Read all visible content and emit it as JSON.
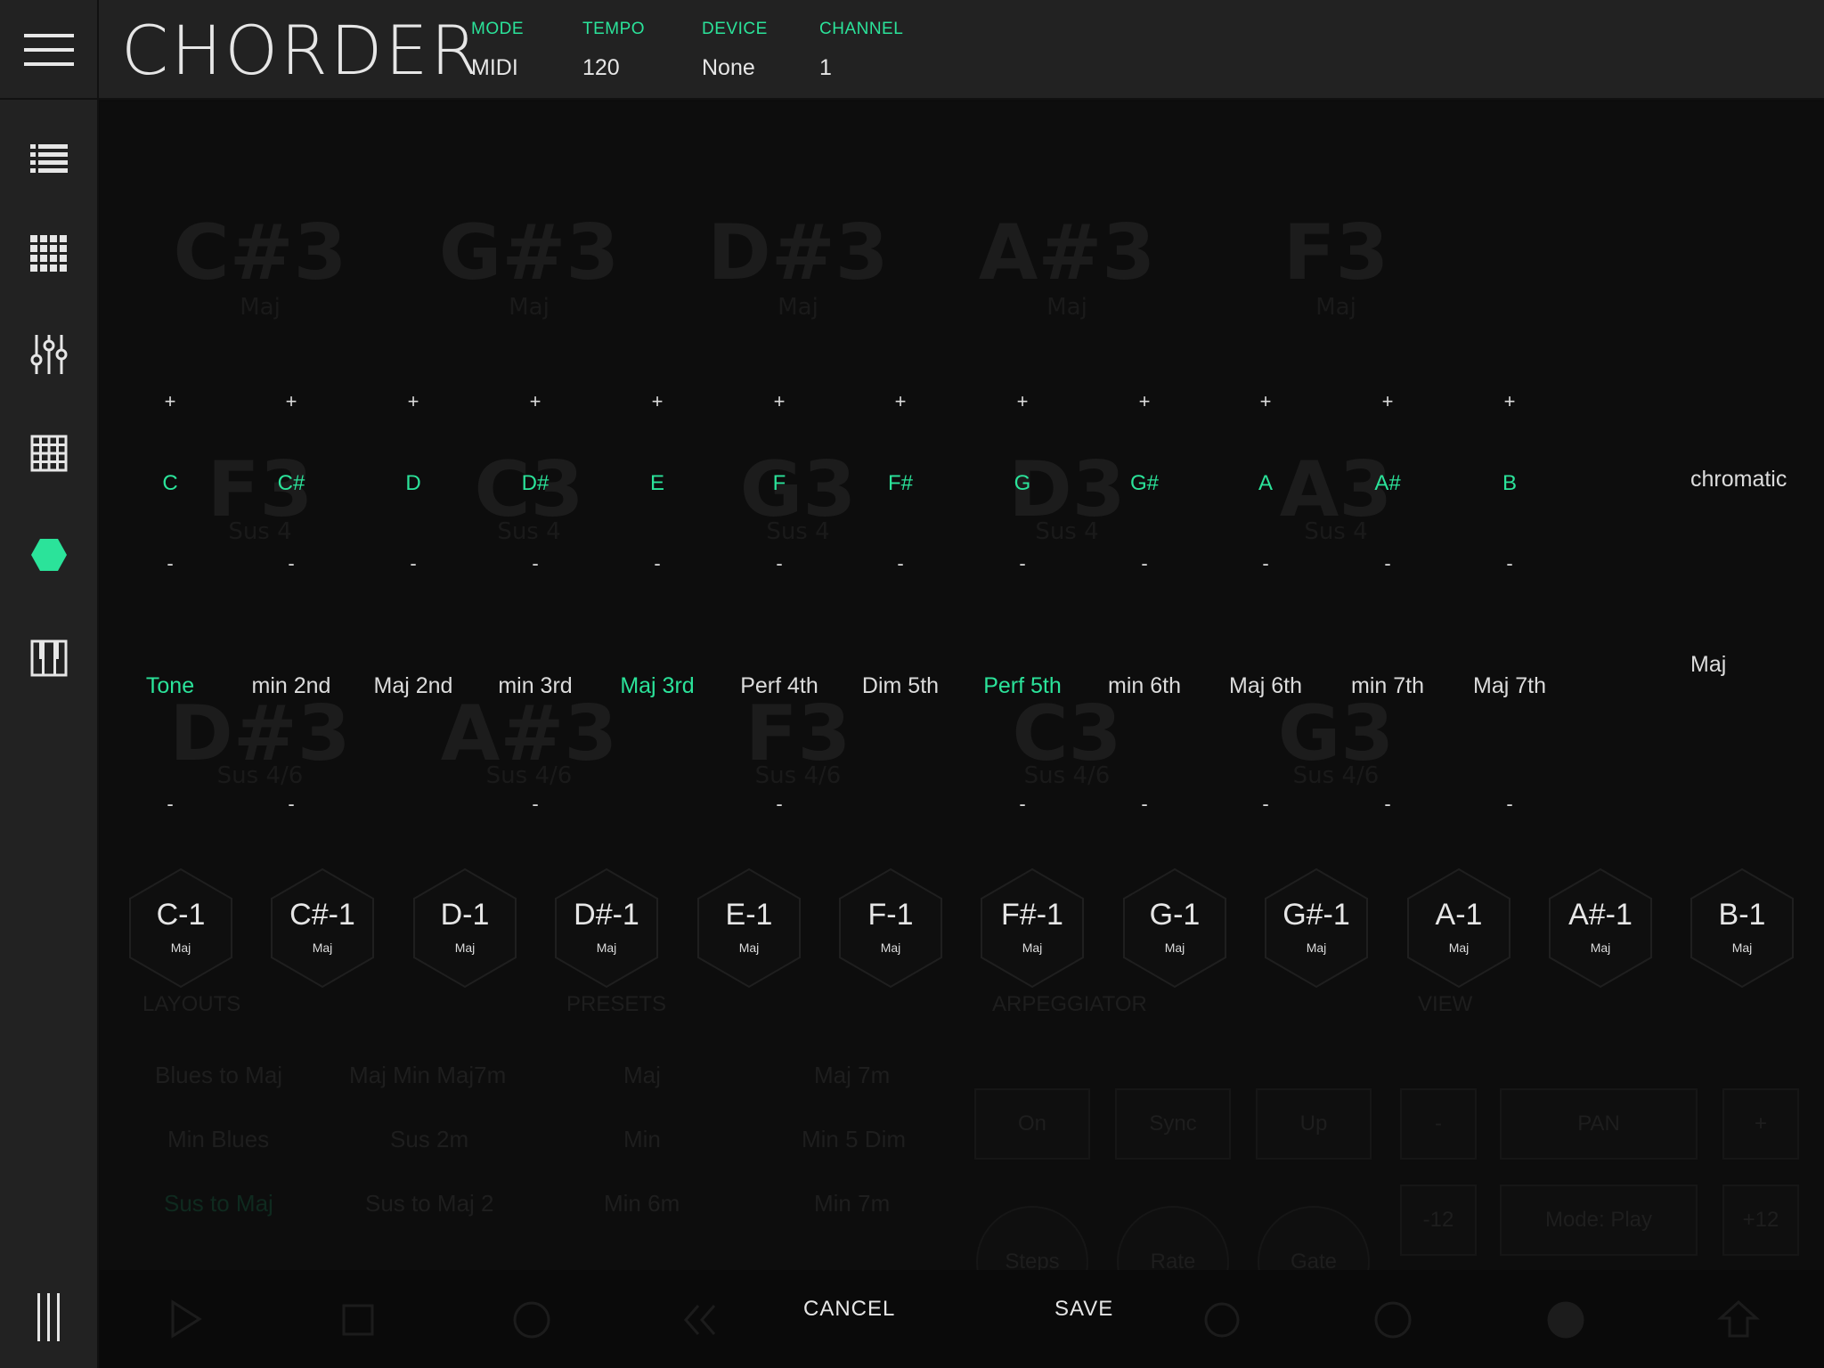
{
  "header": {
    "title": "CHORDER",
    "fields": [
      {
        "label": "MODE",
        "value": "MIDI"
      },
      {
        "label": "TEMPO",
        "value": "120"
      },
      {
        "label": "DEVICE",
        "value": "None"
      },
      {
        "label": "CHANNEL",
        "value": "1"
      }
    ]
  },
  "sidebar": {
    "items": [
      {
        "icon": "list-icon"
      },
      {
        "icon": "grid-icon"
      },
      {
        "icon": "sliders-icon"
      },
      {
        "icon": "matrix-icon"
      },
      {
        "icon": "hexagon-icon",
        "active": true
      },
      {
        "icon": "piano-icon"
      }
    ],
    "bottom_icon": "bars-icon"
  },
  "colors": {
    "accent": "#2be39a",
    "background": "#0c0c0c",
    "panel": "#222222"
  },
  "background_ghost": {
    "row1": [
      {
        "chord": "C#3",
        "quality": "Maj"
      },
      {
        "chord": "G#3",
        "quality": "Maj"
      },
      {
        "chord": "D#3",
        "quality": "Maj"
      },
      {
        "chord": "A#3",
        "quality": "Maj"
      },
      {
        "chord": "F3",
        "quality": "Maj"
      }
    ],
    "row2": [
      {
        "chord": "F3",
        "quality": "Sus 4"
      },
      {
        "chord": "C3",
        "quality": "Sus 4"
      },
      {
        "chord": "G3",
        "quality": "Sus 4"
      },
      {
        "chord": "D3",
        "quality": "Sus 4"
      },
      {
        "chord": "A3",
        "quality": "Sus 4"
      }
    ],
    "row3": [
      {
        "chord": "D#3",
        "quality": "Sus 4/6"
      },
      {
        "chord": "A#3",
        "quality": "Sus 4/6"
      },
      {
        "chord": "F3",
        "quality": "Sus 4/6"
      },
      {
        "chord": "C3",
        "quality": "Sus 4/6"
      },
      {
        "chord": "G3",
        "quality": "Sus 4/6"
      }
    ],
    "panels": {
      "layouts": "LAYOUTS",
      "presets": "PRESETS",
      "arpeggiator": "ARPEGGIATOR",
      "view": "VIEW"
    },
    "layouts": [
      "Blues to Maj",
      "Maj Min Maj7m",
      "Min Blues",
      "Sus 2m",
      "Sus to Maj",
      "Sus to Maj 2"
    ],
    "presets": [
      "Maj",
      "Maj 7m",
      "Min",
      "Min 5 Dim",
      "Min 6m",
      "Min 7m"
    ],
    "arp": [
      "On",
      "Sync",
      "Up",
      "Steps",
      "Rate",
      "Gate"
    ],
    "view": [
      "-",
      "PAN",
      "+",
      "-12",
      "Mode: Play",
      "+12"
    ]
  },
  "scale_editor": {
    "plus_label": "+",
    "minus_label": "-",
    "notes": [
      "C",
      "C#",
      "D",
      "D#",
      "E",
      "F",
      "F#",
      "G",
      "G#",
      "A",
      "A#",
      "B"
    ],
    "scale_dropdown": "chromatic"
  },
  "interval_editor": {
    "intervals": [
      {
        "label": "Tone",
        "active": true
      },
      {
        "label": "min 2nd",
        "active": false
      },
      {
        "label": "Maj 2nd",
        "active": false
      },
      {
        "label": "min 3rd",
        "active": false
      },
      {
        "label": "Maj 3rd",
        "active": true
      },
      {
        "label": "Perf 4th",
        "active": false
      },
      {
        "label": "Dim 5th",
        "active": false
      },
      {
        "label": "Perf 5th",
        "active": true
      },
      {
        "label": "min 6th",
        "active": false
      },
      {
        "label": "Maj 6th",
        "active": false
      },
      {
        "label": "min 7th",
        "active": false
      },
      {
        "label": "Maj 7th",
        "active": false
      }
    ],
    "chord_dropdown": "Maj"
  },
  "chord_pads": [
    {
      "note": "C-1",
      "quality": "Maj"
    },
    {
      "note": "C#-1",
      "quality": "Maj"
    },
    {
      "note": "D-1",
      "quality": "Maj"
    },
    {
      "note": "D#-1",
      "quality": "Maj"
    },
    {
      "note": "E-1",
      "quality": "Maj"
    },
    {
      "note": "F-1",
      "quality": "Maj"
    },
    {
      "note": "F#-1",
      "quality": "Maj"
    },
    {
      "note": "G-1",
      "quality": "Maj"
    },
    {
      "note": "G#-1",
      "quality": "Maj"
    },
    {
      "note": "A-1",
      "quality": "Maj"
    },
    {
      "note": "A#-1",
      "quality": "Maj"
    },
    {
      "note": "B-1",
      "quality": "Maj"
    }
  ],
  "footer": {
    "cancel": "CANCEL",
    "save": "SAVE"
  }
}
